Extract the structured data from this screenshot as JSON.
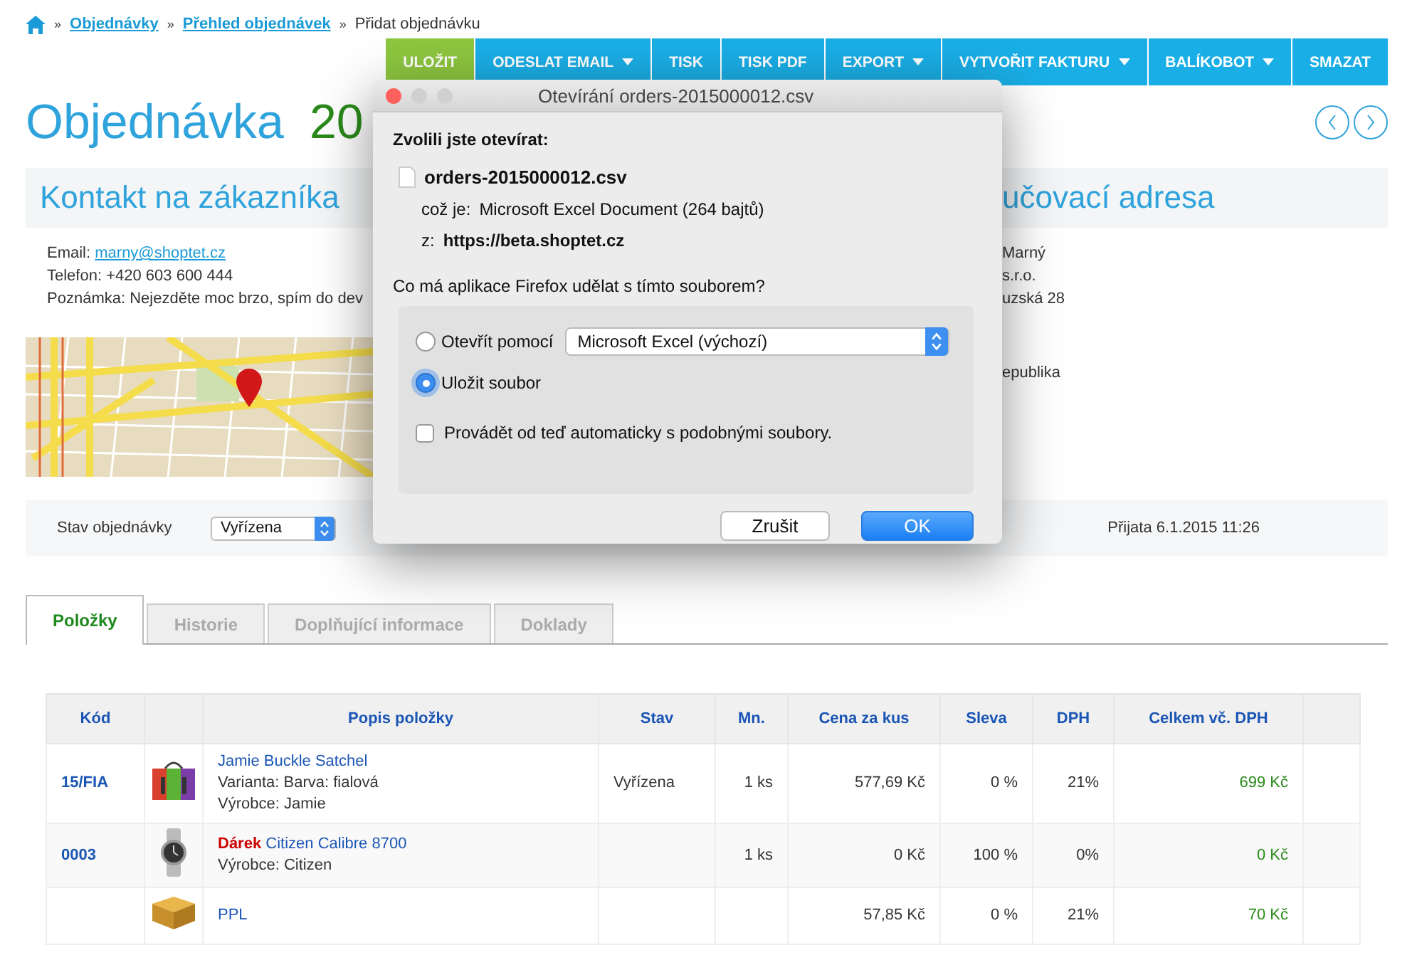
{
  "breadcrumb": {
    "separator": "»",
    "links": [
      "Objednávky",
      "Přehled objednávek"
    ],
    "current": "Přidat objednávku"
  },
  "toolbar": [
    {
      "label": "ULOŽIT",
      "kind": "primary",
      "dropdown": false
    },
    {
      "label": "ODESLAT EMAIL",
      "kind": "default",
      "dropdown": true
    },
    {
      "label": "TISK",
      "kind": "default",
      "dropdown": false
    },
    {
      "label": "TISK PDF",
      "kind": "default",
      "dropdown": false
    },
    {
      "label": "EXPORT",
      "kind": "default",
      "dropdown": true
    },
    {
      "label": "VYTVOŘIT FAKTURU",
      "kind": "default",
      "dropdown": true
    },
    {
      "label": "BALÍKOBOT",
      "kind": "default",
      "dropdown": true
    },
    {
      "label": "SMAZAT",
      "kind": "default",
      "dropdown": false
    }
  ],
  "title": {
    "label": "Objednávka",
    "number": "20"
  },
  "customer": {
    "heading": "Kontakt na zákazníka",
    "email_label": "Email:",
    "email": "marny@shoptet.cz",
    "phone": "Telefon: +420 603 600 444",
    "note": "Poznámka: Nejezděte moc brzo, spím do dev"
  },
  "billing": {
    "heading": "učovací adresa",
    "lines": [
      "Marný",
      "s.r.o.",
      "uzská 28"
    ],
    "country": "epublika"
  },
  "status": {
    "label": "Stav objednávky",
    "value": "Vyřízena",
    "received": "Přijata 6.1.2015 11:26"
  },
  "tabs": [
    {
      "label": "Položky",
      "selected": true
    },
    {
      "label": "Historie",
      "selected": false
    },
    {
      "label": "Doplňující informace",
      "selected": false
    },
    {
      "label": "Doklady",
      "selected": false
    }
  ],
  "table": {
    "columns": [
      "Kód",
      "Popis položky",
      "Stav",
      "Mn.",
      "Cena za kus",
      "Sleva",
      "DPH",
      "Celkem vč. DPH"
    ],
    "rows": [
      {
        "kind": "product",
        "code": "15/FIA",
        "name": "Jamie Buckle Satchel",
        "details": [
          "Varianta: Barva: fialová",
          "Výrobce: Jamie"
        ],
        "status": "Vyřízena",
        "qty": "1 ks",
        "unit_price": "577,69 Kč",
        "discount": "0 %",
        "vat": "21%",
        "total": "699 Kč"
      },
      {
        "kind": "gift",
        "code": "0003",
        "tag": "Dárek",
        "name": "Citizen Calibre 8700",
        "details": [
          "Výrobce: Citizen"
        ],
        "qty": "1 ks",
        "unit_price": "0 Kč",
        "discount": "100 %",
        "vat": "0%",
        "total": "0 Kč"
      },
      {
        "kind": "shipping",
        "name": "PPL",
        "details": [],
        "unit_price": "57,85 Kč",
        "discount": "0 %",
        "vat": "21%",
        "total": "70 Kč"
      }
    ]
  },
  "dialog": {
    "title": "Otevírání orders-2015000012.csv",
    "intro": "Zvolili jste otevírat:",
    "file": "orders-2015000012.csv",
    "type_label": "což je:",
    "type": "Microsoft Excel Document (264 bajtů)",
    "source_label": "z:",
    "source": "https://beta.shoptet.cz",
    "question": "Co má aplikace Firefox udělat s tímto souborem?",
    "options": [
      {
        "kind": "open",
        "label": "Otevřít pomocí",
        "app": "Microsoft Excel (výchozí)",
        "selected": false
      },
      {
        "kind": "save",
        "label": "Uložit soubor",
        "selected": true
      }
    ],
    "remember": {
      "label": "Provádět od teď automaticky s podobnými soubory.",
      "checked": false
    },
    "buttons": [
      {
        "label": "Zrušit",
        "default": false
      },
      {
        "label": "OK",
        "default": true
      }
    ]
  }
}
